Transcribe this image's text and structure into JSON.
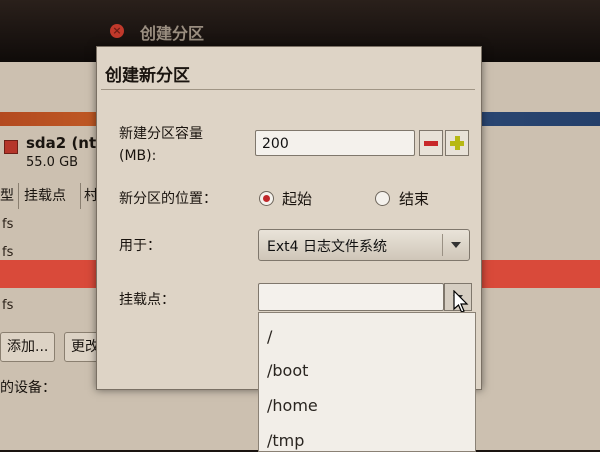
{
  "background": {
    "window_title": "创建分区",
    "disk": {
      "name": "sda2 (nt",
      "size": "55.0 GB"
    },
    "table_headers": [
      "型",
      "挂载点",
      "村"
    ],
    "rows": [
      "fs",
      "fs",
      "fs"
    ],
    "buttons": {
      "add": "添加...",
      "change": "更改"
    },
    "device_label": "的设备："
  },
  "dialog": {
    "title": "创建新分区",
    "size_label_line1": "新建分区容量",
    "size_label_line2": "(MB):",
    "size_value": "200",
    "location_label": "新分区的位置：",
    "location_options": {
      "start": "起始",
      "end": "结束",
      "selected": "start"
    },
    "use_as_label": "用于：",
    "use_as_value": "Ext4 日志文件系统",
    "mount_label": "挂载点：",
    "mount_value": ""
  },
  "mount_options": [
    "/",
    "/boot",
    "/home",
    "/tmp"
  ],
  "colors": {
    "accent_red": "#c0272a",
    "plus_green": "#b7b814"
  }
}
